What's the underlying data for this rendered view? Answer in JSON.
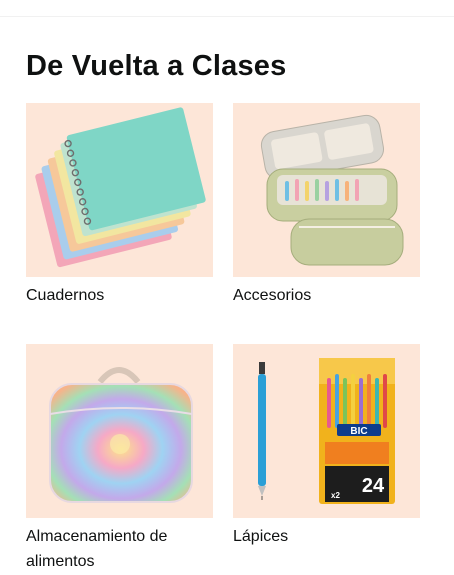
{
  "section": {
    "title": "De Vuelta a Clases"
  },
  "cards": [
    {
      "label": "Cuadernos",
      "image": "notebooks-image"
    },
    {
      "label": "Accesorios",
      "image": "pencil-case-image"
    },
    {
      "label": "Almacenamiento de alimentos",
      "image": "lunch-bag-image"
    },
    {
      "label": "Lápices",
      "image": "mechanical-pencils-image"
    }
  ],
  "pencil_pack": {
    "brand": "BIC",
    "count": "24",
    "multiplier": "x2"
  },
  "colors": {
    "tile_background": "#fde6d8",
    "text": "#0f1111"
  }
}
